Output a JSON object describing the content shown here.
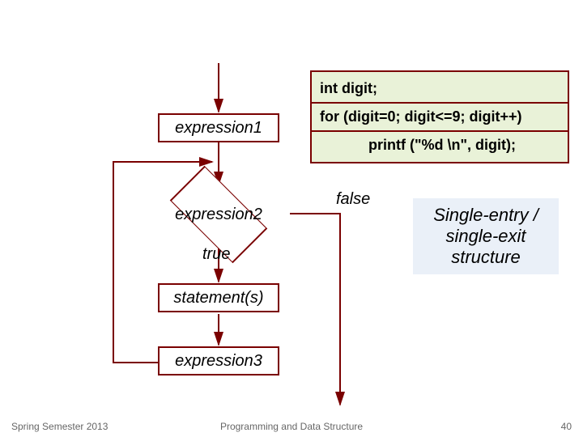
{
  "flow": {
    "expr1": "expression1",
    "expr2": "expression2",
    "true_label": "true",
    "false_label": "false",
    "stmt": "statement(s)",
    "expr3": "expression3"
  },
  "code": {
    "decl": "int  digit;",
    "for_head": "for  (digit=0; digit<=9; digit++)",
    "body": "printf (\"%d \\n\", digit);"
  },
  "annotation": {
    "line1": "Single-entry /",
    "line2": "single-exit",
    "line3": "structure"
  },
  "footer": {
    "left": "Spring Semester 2013",
    "center": "Programming and Data Structure",
    "right": "40"
  },
  "colors": {
    "border": "#7a0000",
    "code_bg": "#e9f2d8",
    "anno_bg": "#eaf0f8"
  }
}
